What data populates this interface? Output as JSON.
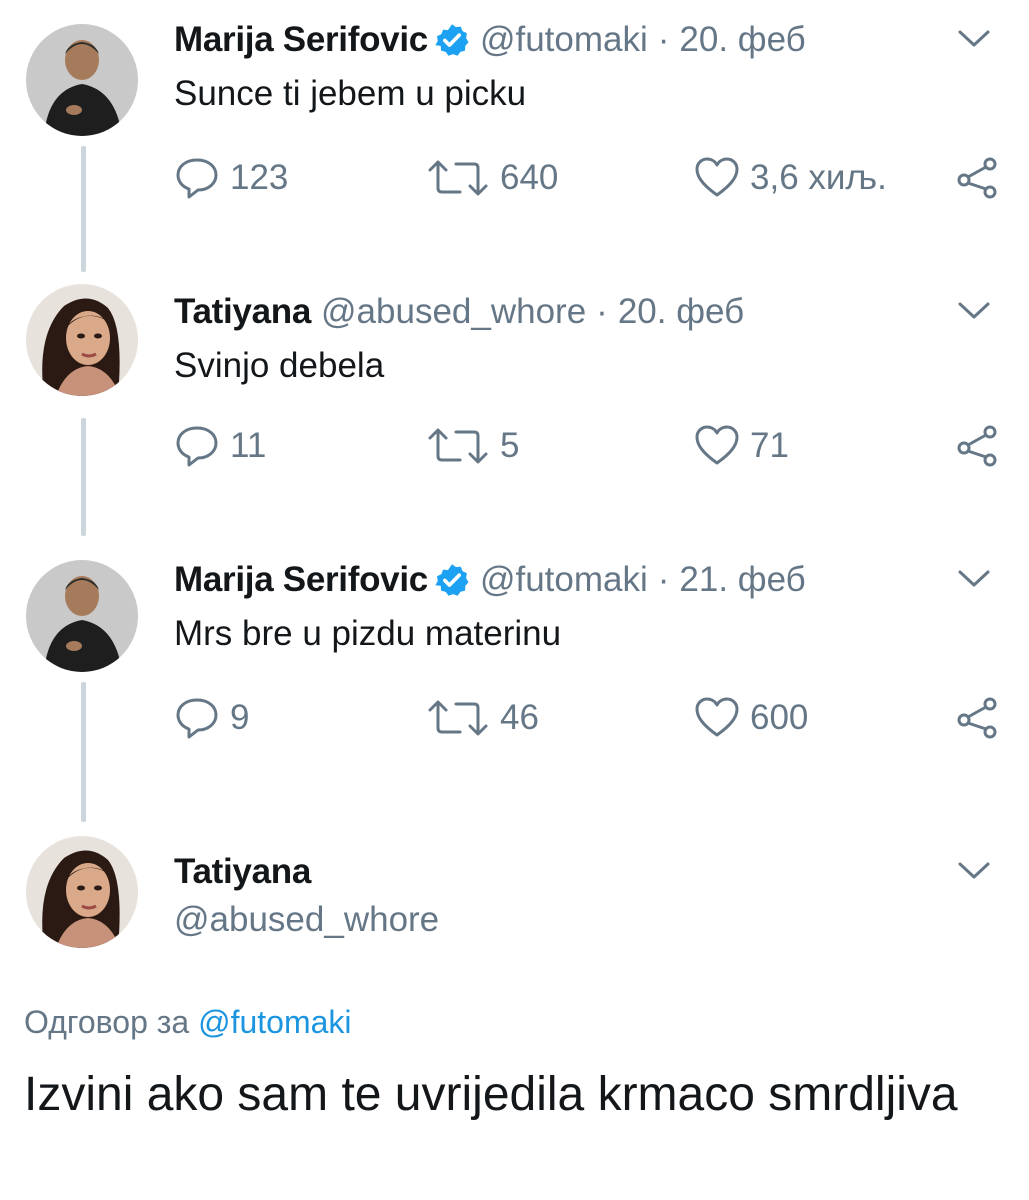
{
  "tweets": [
    {
      "name": "Marija Serifovic",
      "verified": true,
      "handle": "@futomaki",
      "separator": "·",
      "date": "20. феб",
      "text": "Sunce ti jebem u picku",
      "replies": "123",
      "retweets": "640",
      "likes": "3,6 хиљ."
    },
    {
      "name": "Tatiyana",
      "verified": false,
      "handle": "@abused_whore",
      "separator": "·",
      "date": "20. феб",
      "text": "Svinjo debela",
      "replies": "11",
      "retweets": "5",
      "likes": "71"
    },
    {
      "name": "Marija Serifovic",
      "verified": true,
      "handle": "@futomaki",
      "separator": "·",
      "date": "21. феб",
      "text": "Mrs bre u pizdu materinu",
      "replies": "9",
      "retweets": "46",
      "likes": "600"
    }
  ],
  "final_tweet": {
    "name": "Tatiyana",
    "handle": "@abused_whore",
    "reply_prefix": "Одговор за",
    "reply_mention": "@futomaki",
    "text": "Izvini ako sam te uvrijedila krmaco smrdljiva"
  },
  "icons": {
    "reply": "reply-bubble-icon",
    "retweet": "retweet-icon",
    "like": "heart-icon",
    "share": "share-icon",
    "menu": "chevron-down-icon",
    "verified": "verified-badge-icon"
  },
  "colors": {
    "text": "#14171a",
    "secondary": "#657786",
    "link": "#1b95e0",
    "verified": "#1da1f2",
    "thread_line": "#ccd6dd"
  }
}
